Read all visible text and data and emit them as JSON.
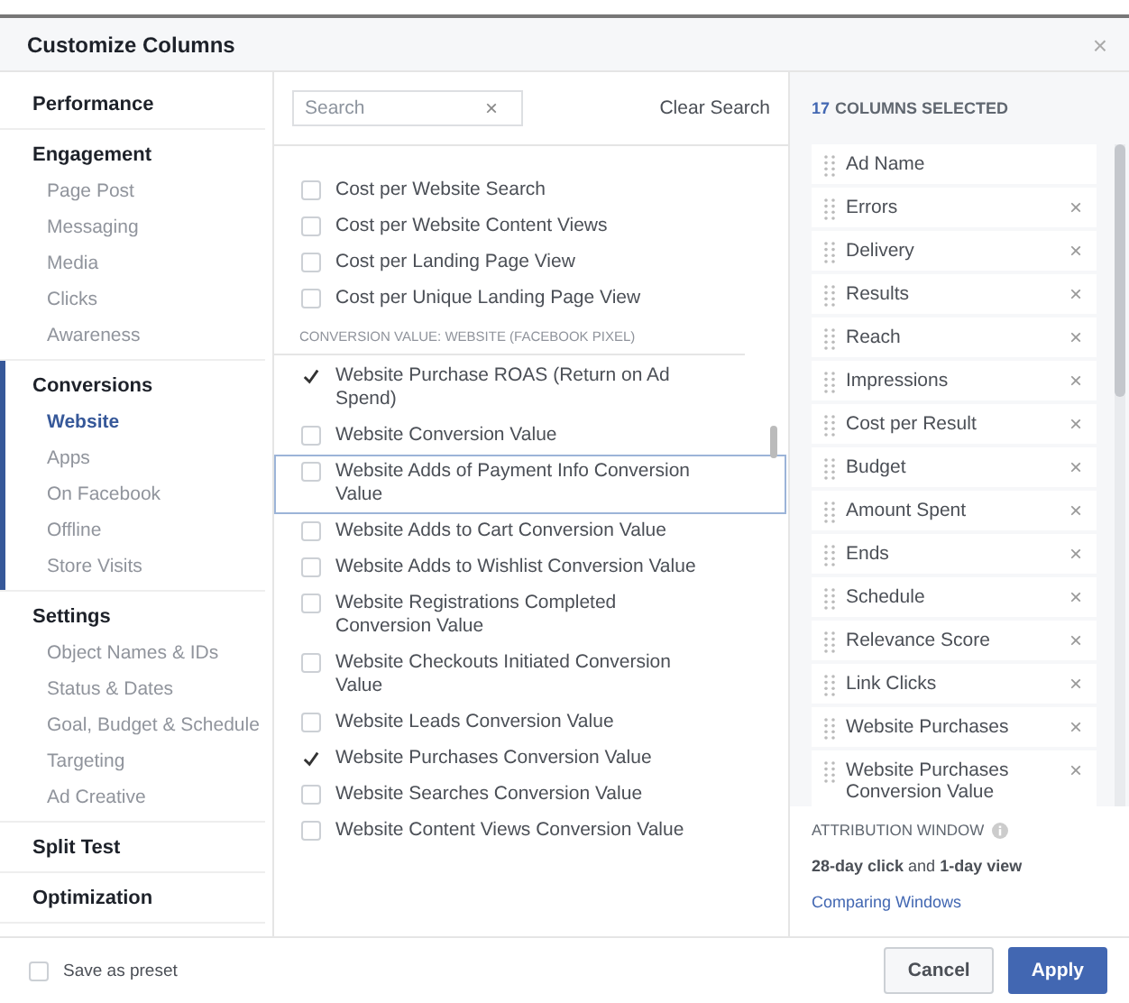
{
  "dialog": {
    "title": "Customize Columns",
    "close": "×"
  },
  "sidebar": [
    {
      "title": "Performance",
      "active": false
    },
    {
      "title": "Engagement",
      "active": false,
      "items": [
        {
          "label": "Page Post",
          "selected": false
        },
        {
          "label": "Messaging",
          "selected": false
        },
        {
          "label": "Media",
          "selected": false
        },
        {
          "label": "Clicks",
          "selected": false
        },
        {
          "label": "Awareness",
          "selected": false
        }
      ]
    },
    {
      "title": "Conversions",
      "active": true,
      "items": [
        {
          "label": "Website",
          "selected": true
        },
        {
          "label": "Apps",
          "selected": false
        },
        {
          "label": "On Facebook",
          "selected": false
        },
        {
          "label": "Offline",
          "selected": false
        },
        {
          "label": "Store Visits",
          "selected": false
        }
      ]
    },
    {
      "title": "Settings",
      "active": false,
      "items": [
        {
          "label": "Object Names & IDs",
          "selected": false
        },
        {
          "label": "Status & Dates",
          "selected": false
        },
        {
          "label": "Goal, Budget & Schedule",
          "selected": false
        },
        {
          "label": "Targeting",
          "selected": false
        },
        {
          "label": "Ad Creative",
          "selected": false
        }
      ]
    },
    {
      "title": "Split Test",
      "active": false
    },
    {
      "title": "Optimization",
      "active": false
    }
  ],
  "search": {
    "placeholder": "Search",
    "clear_icon": "×",
    "clear_label": "Clear Search"
  },
  "metrics": [
    {
      "kind": "option",
      "label": "Cost per Website Search",
      "checked": false,
      "highlighted": false
    },
    {
      "kind": "option",
      "label": "Cost per Website Content Views",
      "checked": false,
      "highlighted": false
    },
    {
      "kind": "option",
      "label": "Cost per Landing Page View",
      "checked": false,
      "highlighted": false
    },
    {
      "kind": "option",
      "label": "Cost per Unique Landing Page View",
      "checked": false,
      "highlighted": false
    },
    {
      "kind": "section",
      "label": "CONVERSION VALUE: WEBSITE (FACEBOOK PIXEL)"
    },
    {
      "kind": "option",
      "label": "Website Purchase ROAS (Return on Ad Spend)",
      "checked": true,
      "highlighted": false
    },
    {
      "kind": "option",
      "label": "Website Conversion Value",
      "checked": false,
      "highlighted": false
    },
    {
      "kind": "option",
      "label": "Website Adds of Payment Info Conversion Value",
      "checked": false,
      "highlighted": true
    },
    {
      "kind": "option",
      "label": "Website Adds to Cart Conversion Value",
      "checked": false,
      "highlighted": false
    },
    {
      "kind": "option",
      "label": "Website Adds to Wishlist Conversion Value",
      "checked": false,
      "highlighted": false
    },
    {
      "kind": "option",
      "label": "Website Registrations Completed Conversion Value",
      "checked": false,
      "highlighted": false
    },
    {
      "kind": "option",
      "label": "Website Checkouts Initiated Conversion Value",
      "checked": false,
      "highlighted": false
    },
    {
      "kind": "option",
      "label": "Website Leads Conversion Value",
      "checked": false,
      "highlighted": false
    },
    {
      "kind": "option",
      "label": "Website Purchases Conversion Value",
      "checked": true,
      "highlighted": false
    },
    {
      "kind": "option",
      "label": "Website Searches Conversion Value",
      "checked": false,
      "highlighted": false
    },
    {
      "kind": "option",
      "label": "Website Content Views Conversion Value",
      "checked": false,
      "highlighted": false
    }
  ],
  "selected_columns": {
    "count": "17",
    "label": "COLUMNS SELECTED",
    "items": [
      {
        "label": "Ad Name",
        "removable": false
      },
      {
        "label": "Errors",
        "removable": true
      },
      {
        "label": "Delivery",
        "removable": true
      },
      {
        "label": "Results",
        "removable": true
      },
      {
        "label": "Reach",
        "removable": true
      },
      {
        "label": "Impressions",
        "removable": true
      },
      {
        "label": "Cost per Result",
        "removable": true
      },
      {
        "label": "Budget",
        "removable": true
      },
      {
        "label": "Amount Spent",
        "removable": true
      },
      {
        "label": "Ends",
        "removable": true
      },
      {
        "label": "Schedule",
        "removable": true
      },
      {
        "label": "Relevance Score",
        "removable": true
      },
      {
        "label": "Link Clicks",
        "removable": true
      },
      {
        "label": "Website Purchases",
        "removable": true
      },
      {
        "label": "Website Purchases Conversion Value",
        "removable": true
      }
    ],
    "remove_icon": "×"
  },
  "attribution": {
    "title": "ATTRIBUTION WINDOW",
    "value": "**28-day click** and **1-day view**",
    "link": "Comparing Windows"
  },
  "footer": {
    "preset_label": "Save as preset",
    "preset_checked": false,
    "buttons": [
      {
        "label": "Cancel",
        "kind": "secondary"
      },
      {
        "label": "Apply",
        "kind": "primary"
      }
    ]
  }
}
